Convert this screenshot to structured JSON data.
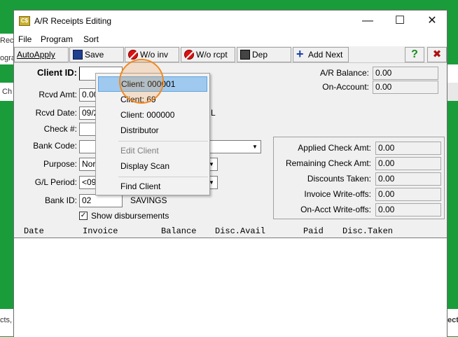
{
  "background_app": {
    "fragments": [
      "Rec",
      "ogra",
      "Ch",
      "cts, 0",
      "ect"
    ]
  },
  "window": {
    "title": "A/R Receipts Editing",
    "icon_text": "C$",
    "minimize_label": "—",
    "maximize_label": "☐",
    "close_label": "✕"
  },
  "menu": [
    "File",
    "Program",
    "Sort"
  ],
  "toolbar": {
    "autoapply": "AutoApply",
    "save": "Save",
    "wo_inv": "W/o inv",
    "wo_rcpt": "W/o rcpt",
    "dep": "Dep",
    "add_next": "Add Next",
    "help": "?",
    "close": "✖"
  },
  "form": {
    "client_id_label": "Client ID:",
    "client_id_value": "",
    "rcvd_amt_label": "Rcvd Amt:",
    "rcvd_amt_value": "0.00",
    "rcvd_date_label": "Rcvd Date:",
    "rcvd_date_value": "09/2",
    "rcvd_date_suffix": "L",
    "check_label": "Check #:",
    "check_value": "",
    "bank_code_label": "Bank Code:",
    "bank_code_value": "",
    "purpose_label": "Purpose:",
    "purpose_value": "Nor",
    "gl_period_label": "G/L Period:",
    "gl_period_value": "<09",
    "bank_id_label": "Bank ID:",
    "bank_id_value": "02",
    "bank_id_name": "SAVINGS",
    "show_disbursements_label": "Show disbursements",
    "show_disbursements_checked": "✓"
  },
  "balances": {
    "ar_balance_label": "A/R Balance:",
    "ar_balance_value": "0.00",
    "on_account_label": "On-Account:",
    "on_account_value": "0.00"
  },
  "summary": {
    "rows": [
      {
        "label": "Applied Check Amt:",
        "value": "0.00"
      },
      {
        "label": "Remaining Check Amt:",
        "value": "0.00"
      },
      {
        "label": "Discounts Taken:",
        "value": "0.00"
      },
      {
        "label": "Invoice Write-offs:",
        "value": "0.00"
      },
      {
        "label": "On-Acct Write-offs:",
        "value": "0.00"
      }
    ]
  },
  "grid": {
    "columns": [
      "Date",
      "Invoice",
      "Balance",
      "Disc.Avail",
      "Paid",
      "Disc.Taken"
    ]
  },
  "popup": {
    "items": [
      "Client: 000001",
      "Client: 69",
      "Client: 000000",
      "Distributor",
      "Edit Client",
      "Display Scan",
      "Find Client"
    ]
  },
  "colors": {
    "desktop": "#1a9c3a",
    "selection": "#9fc9ee",
    "click_highlight": "#f08a24"
  }
}
